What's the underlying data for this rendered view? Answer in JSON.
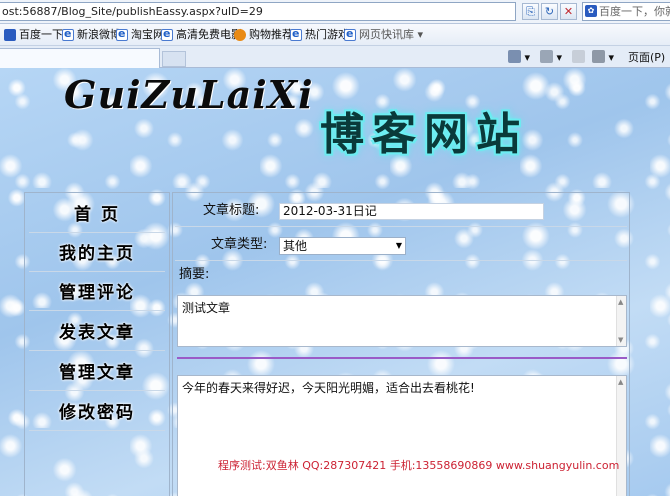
{
  "browser": {
    "address": "ost:56887/Blog_Site/publishEassy.aspx?uID=29",
    "search_placeholder": "百度一下，你就知",
    "favorites": [
      {
        "label": "百度一下",
        "icon": "baidu-paw-icon"
      },
      {
        "label": "新浪微博",
        "icon": "ie-page-icon"
      },
      {
        "label": "淘宝网",
        "icon": "ie-page-icon"
      },
      {
        "label": "高清免费电影",
        "icon": "ie-page-icon"
      },
      {
        "label": "购物推荐",
        "icon": "gift-icon"
      },
      {
        "label": "热门游戏",
        "icon": "ie-page-icon"
      },
      {
        "label": "网页快讯库 ▾",
        "icon": "ie-page-icon"
      }
    ],
    "page_menu": "页面(P)"
  },
  "site": {
    "logo_left": "GuiZuLaiXi",
    "logo_right": "博客网站"
  },
  "menu": {
    "items": [
      "首 页",
      "我的主页",
      "管理评论",
      "发表文章",
      "管理文章",
      "修改密码"
    ]
  },
  "form": {
    "title_label": "文章标题:",
    "title_value": "2012-03-31日记",
    "type_label": "文章类型:",
    "type_value": "其他",
    "summary_label": "摘要:",
    "summary_value": "测试文章",
    "content_value": "今年的春天来得好迟，今天阳光明媚，适合出去看桃花!"
  },
  "footer": {
    "credit": "程序测试:双鱼林 QQ:287307421 手机:13558690869 www.shuangyulin.com"
  }
}
